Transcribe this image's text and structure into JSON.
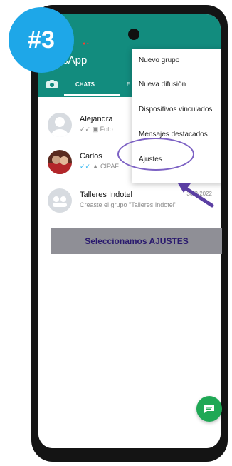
{
  "step_badge": "#3",
  "header": {
    "app_title": "tsApp",
    "tabs": {
      "chats": "CHATS"
    }
  },
  "menu": {
    "items": [
      "Nuevo grupo",
      "Nueva difusión",
      "Dispositivos vinculados",
      "Mensajes destacados",
      "Ajustes"
    ]
  },
  "chats": [
    {
      "name": "Alejandra",
      "preview": "Foto",
      "date": ""
    },
    {
      "name": "Carlos",
      "preview": "CIPAF",
      "date": ""
    },
    {
      "name": "Talleres Indotel",
      "preview": "Creaste el grupo \"Talleres Indotel\"",
      "date": "30/3/2022"
    }
  ],
  "caption": "Seleccionamos AJUSTES",
  "icons": {
    "camera": "camera-icon",
    "new_chat": "new-chat-icon",
    "group": "group-avatar-icon",
    "person": "person-avatar-icon",
    "arrow": "arrow-icon"
  },
  "colors": {
    "whatsapp_green": "#128c7e",
    "fab_green": "#1fa855",
    "badge_blue": "#1ea7e8",
    "highlight_purple": "#7d62c4",
    "caption_bg": "#8f8f96",
    "caption_text": "#2a1a6e"
  }
}
